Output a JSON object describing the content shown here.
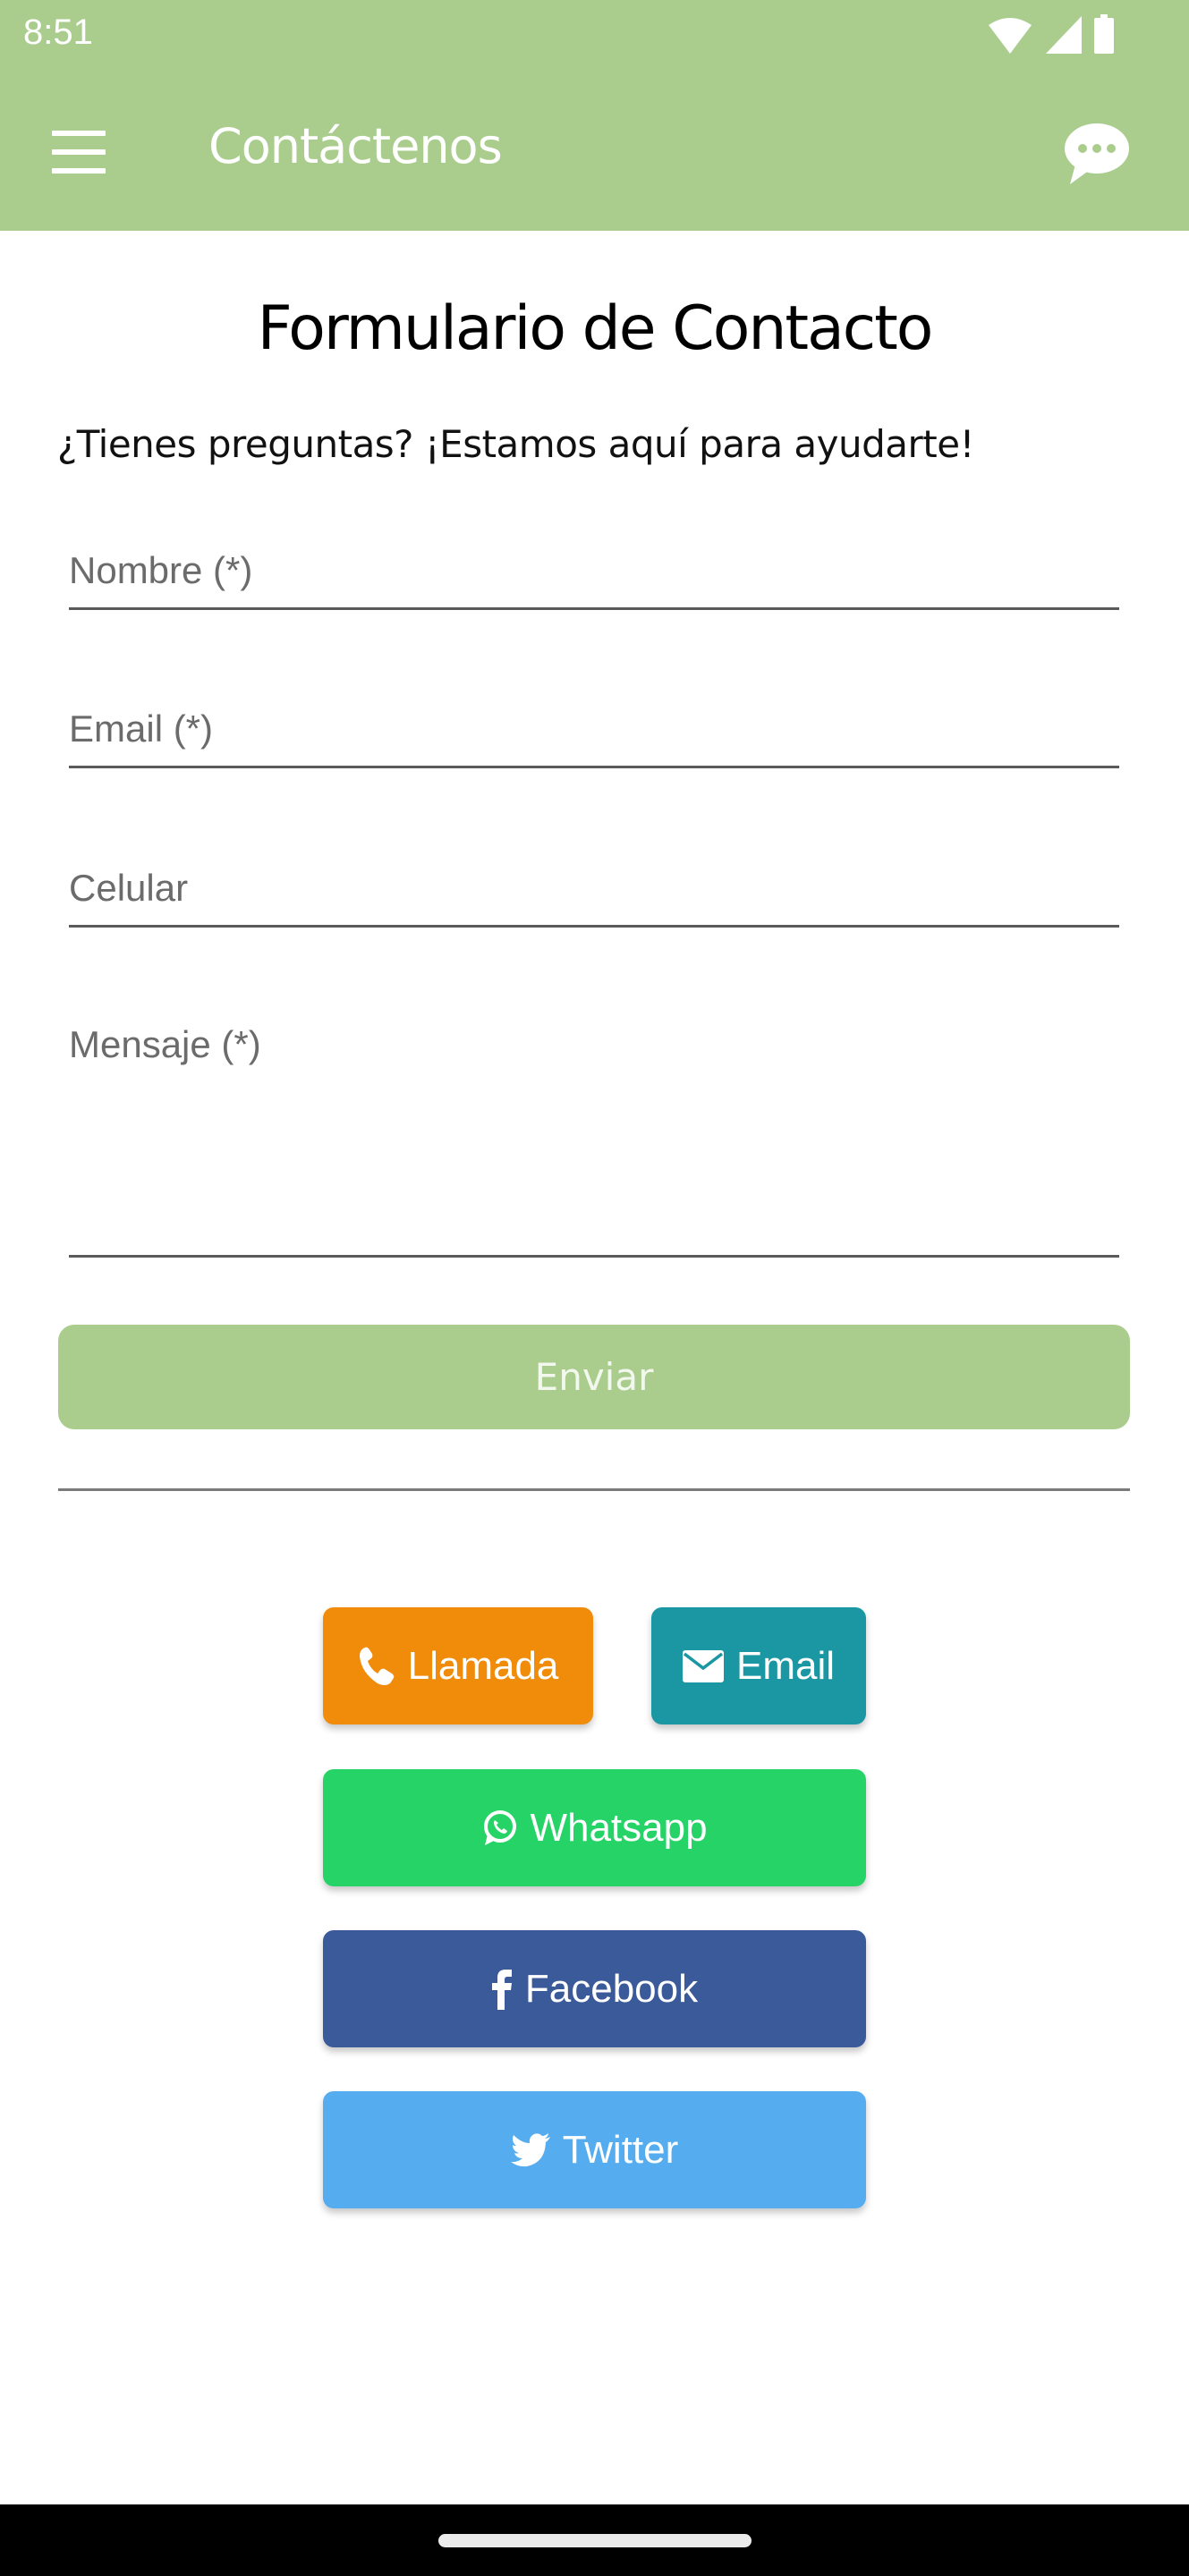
{
  "status_bar": {
    "time": "8:51",
    "icons": [
      "wifi-icon",
      "signal-icon",
      "battery-icon"
    ]
  },
  "app_bar": {
    "title": "Contáctenos",
    "menu_icon": "hamburger-menu-icon",
    "action_icon": "chat-bubble-icon",
    "background": "#aacd8e"
  },
  "form": {
    "title": "Formulario de Contacto",
    "subtitle": "¿Tienes preguntas? ¡Estamos aquí para ayudarte!",
    "fields": [
      {
        "label": "Nombre (*)",
        "value": ""
      },
      {
        "label": "Email (*)",
        "value": ""
      },
      {
        "label": "Celular",
        "value": ""
      },
      {
        "label": "Mensaje (*)",
        "value": ""
      }
    ],
    "submit_label": "Enviar"
  },
  "contact_buttons": [
    {
      "label": "Llamada",
      "icon": "phone-icon",
      "color": "#f08c0a"
    },
    {
      "label": "Email",
      "icon": "envelope-icon",
      "color": "#1a97a3"
    },
    {
      "label": "Whatsapp",
      "icon": "whatsapp-icon",
      "color": "#26d366"
    },
    {
      "label": "Facebook",
      "icon": "facebook-icon",
      "color": "#3b5a9a"
    },
    {
      "label": "Twitter",
      "icon": "twitter-icon",
      "color": "#55acee"
    }
  ]
}
